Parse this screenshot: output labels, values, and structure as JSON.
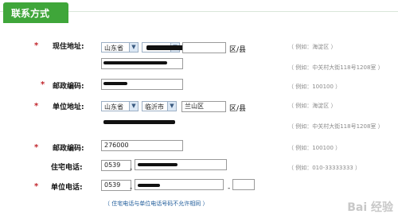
{
  "section": {
    "title": "联系方式"
  },
  "fields": {
    "current_address": {
      "label": "现住地址:",
      "province": "山东省",
      "district_suffix": "区/县",
      "hint_district": "（ 例如：海淀区 ）",
      "hint_street": "（ 例如：中关村大街118号1208室 ）"
    },
    "postal_code_1": {
      "label": "邮政编码:",
      "hint": "（ 例如：100100 ）"
    },
    "work_address": {
      "label": "单位地址:",
      "province": "山东省",
      "city": "临沂市",
      "district": "兰山区",
      "district_suffix": "区/县",
      "hint_district": "（ 例如：海淀区 ）",
      "hint_street": "（ 例如：中关村大街118号1208室 ）"
    },
    "postal_code_2": {
      "label": "邮政编码:",
      "value": "276000",
      "hint": "（ 例如：100100 ）"
    },
    "home_phone": {
      "label": "住宅电话:",
      "area": "0539",
      "dash": "-",
      "hint": "（ 例如：010-33333333 ）"
    },
    "work_phone": {
      "label": "单位电话:",
      "area": "0539",
      "dash": "-",
      "dash2": "-"
    },
    "phone_note": "（ 住宅电话与单位电话号码不允许相同 ）"
  },
  "watermark": "Bai 经验",
  "colors": {
    "header_green": "#3fa63a",
    "required_red": "#c0232a",
    "note_blue": "#1e5b9a"
  }
}
